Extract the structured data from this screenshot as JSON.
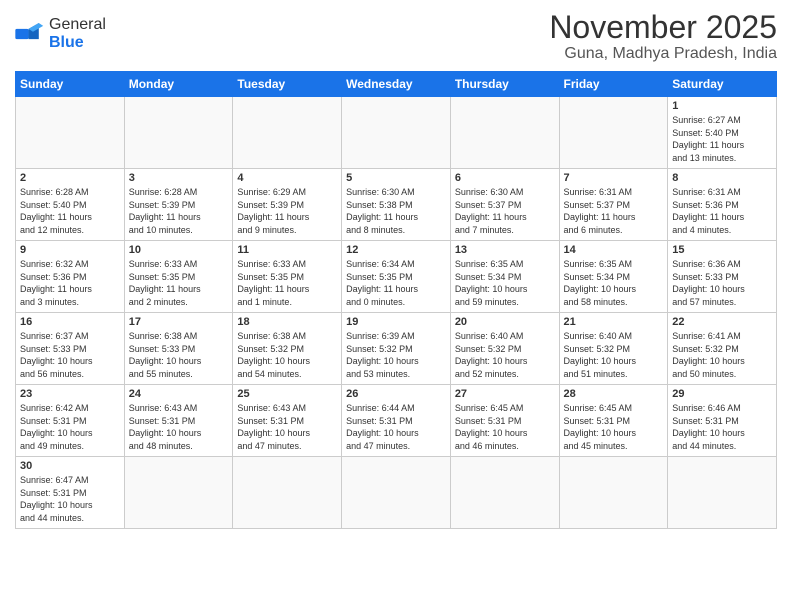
{
  "logo": {
    "text_general": "General",
    "text_blue": "Blue"
  },
  "title": "November 2025",
  "subtitle": "Guna, Madhya Pradesh, India",
  "weekdays": [
    "Sunday",
    "Monday",
    "Tuesday",
    "Wednesday",
    "Thursday",
    "Friday",
    "Saturday"
  ],
  "weeks": [
    [
      {
        "day": "",
        "info": ""
      },
      {
        "day": "",
        "info": ""
      },
      {
        "day": "",
        "info": ""
      },
      {
        "day": "",
        "info": ""
      },
      {
        "day": "",
        "info": ""
      },
      {
        "day": "",
        "info": ""
      },
      {
        "day": "1",
        "info": "Sunrise: 6:27 AM\nSunset: 5:40 PM\nDaylight: 11 hours\nand 13 minutes."
      }
    ],
    [
      {
        "day": "2",
        "info": "Sunrise: 6:28 AM\nSunset: 5:40 PM\nDaylight: 11 hours\nand 12 minutes."
      },
      {
        "day": "3",
        "info": "Sunrise: 6:28 AM\nSunset: 5:39 PM\nDaylight: 11 hours\nand 10 minutes."
      },
      {
        "day": "4",
        "info": "Sunrise: 6:29 AM\nSunset: 5:39 PM\nDaylight: 11 hours\nand 9 minutes."
      },
      {
        "day": "5",
        "info": "Sunrise: 6:30 AM\nSunset: 5:38 PM\nDaylight: 11 hours\nand 8 minutes."
      },
      {
        "day": "6",
        "info": "Sunrise: 6:30 AM\nSunset: 5:37 PM\nDaylight: 11 hours\nand 7 minutes."
      },
      {
        "day": "7",
        "info": "Sunrise: 6:31 AM\nSunset: 5:37 PM\nDaylight: 11 hours\nand 6 minutes."
      },
      {
        "day": "8",
        "info": "Sunrise: 6:31 AM\nSunset: 5:36 PM\nDaylight: 11 hours\nand 4 minutes."
      }
    ],
    [
      {
        "day": "9",
        "info": "Sunrise: 6:32 AM\nSunset: 5:36 PM\nDaylight: 11 hours\nand 3 minutes."
      },
      {
        "day": "10",
        "info": "Sunrise: 6:33 AM\nSunset: 5:35 PM\nDaylight: 11 hours\nand 2 minutes."
      },
      {
        "day": "11",
        "info": "Sunrise: 6:33 AM\nSunset: 5:35 PM\nDaylight: 11 hours\nand 1 minute."
      },
      {
        "day": "12",
        "info": "Sunrise: 6:34 AM\nSunset: 5:35 PM\nDaylight: 11 hours\nand 0 minutes."
      },
      {
        "day": "13",
        "info": "Sunrise: 6:35 AM\nSunset: 5:34 PM\nDaylight: 10 hours\nand 59 minutes."
      },
      {
        "day": "14",
        "info": "Sunrise: 6:35 AM\nSunset: 5:34 PM\nDaylight: 10 hours\nand 58 minutes."
      },
      {
        "day": "15",
        "info": "Sunrise: 6:36 AM\nSunset: 5:33 PM\nDaylight: 10 hours\nand 57 minutes."
      }
    ],
    [
      {
        "day": "16",
        "info": "Sunrise: 6:37 AM\nSunset: 5:33 PM\nDaylight: 10 hours\nand 56 minutes."
      },
      {
        "day": "17",
        "info": "Sunrise: 6:38 AM\nSunset: 5:33 PM\nDaylight: 10 hours\nand 55 minutes."
      },
      {
        "day": "18",
        "info": "Sunrise: 6:38 AM\nSunset: 5:32 PM\nDaylight: 10 hours\nand 54 minutes."
      },
      {
        "day": "19",
        "info": "Sunrise: 6:39 AM\nSunset: 5:32 PM\nDaylight: 10 hours\nand 53 minutes."
      },
      {
        "day": "20",
        "info": "Sunrise: 6:40 AM\nSunset: 5:32 PM\nDaylight: 10 hours\nand 52 minutes."
      },
      {
        "day": "21",
        "info": "Sunrise: 6:40 AM\nSunset: 5:32 PM\nDaylight: 10 hours\nand 51 minutes."
      },
      {
        "day": "22",
        "info": "Sunrise: 6:41 AM\nSunset: 5:32 PM\nDaylight: 10 hours\nand 50 minutes."
      }
    ],
    [
      {
        "day": "23",
        "info": "Sunrise: 6:42 AM\nSunset: 5:31 PM\nDaylight: 10 hours\nand 49 minutes."
      },
      {
        "day": "24",
        "info": "Sunrise: 6:43 AM\nSunset: 5:31 PM\nDaylight: 10 hours\nand 48 minutes."
      },
      {
        "day": "25",
        "info": "Sunrise: 6:43 AM\nSunset: 5:31 PM\nDaylight: 10 hours\nand 47 minutes."
      },
      {
        "day": "26",
        "info": "Sunrise: 6:44 AM\nSunset: 5:31 PM\nDaylight: 10 hours\nand 47 minutes."
      },
      {
        "day": "27",
        "info": "Sunrise: 6:45 AM\nSunset: 5:31 PM\nDaylight: 10 hours\nand 46 minutes."
      },
      {
        "day": "28",
        "info": "Sunrise: 6:45 AM\nSunset: 5:31 PM\nDaylight: 10 hours\nand 45 minutes."
      },
      {
        "day": "29",
        "info": "Sunrise: 6:46 AM\nSunset: 5:31 PM\nDaylight: 10 hours\nand 44 minutes."
      }
    ],
    [
      {
        "day": "30",
        "info": "Sunrise: 6:47 AM\nSunset: 5:31 PM\nDaylight: 10 hours\nand 44 minutes."
      },
      {
        "day": "",
        "info": ""
      },
      {
        "day": "",
        "info": ""
      },
      {
        "day": "",
        "info": ""
      },
      {
        "day": "",
        "info": ""
      },
      {
        "day": "",
        "info": ""
      },
      {
        "day": "",
        "info": ""
      }
    ]
  ]
}
